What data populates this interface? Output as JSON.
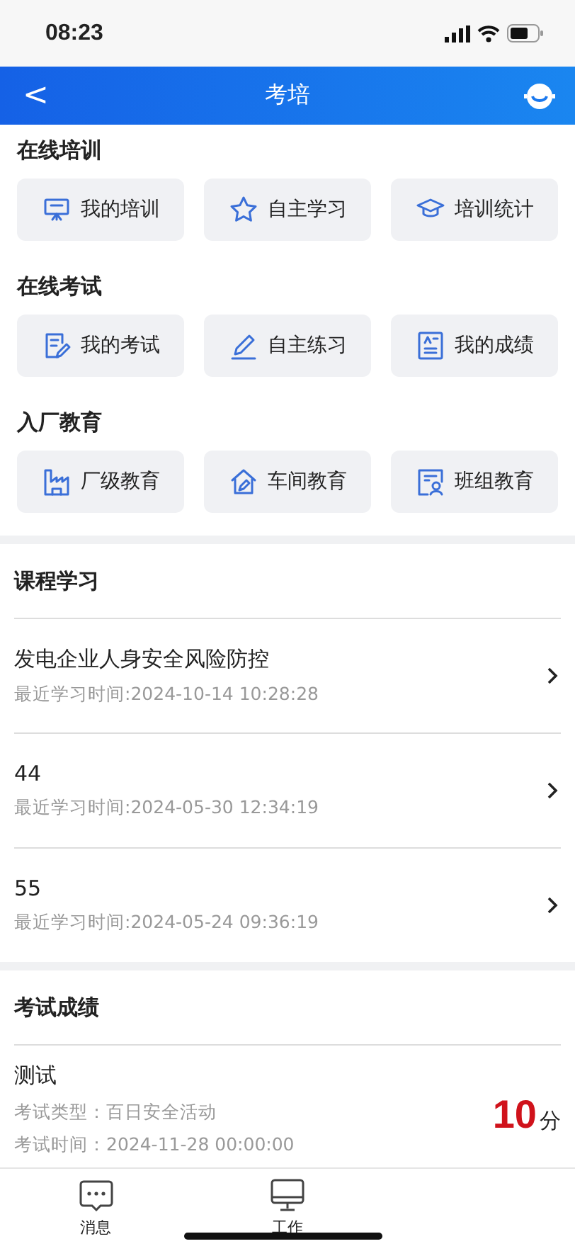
{
  "status_bar": {
    "time": "08:23"
  },
  "nav": {
    "back": "<",
    "title": "考培"
  },
  "sections": [
    {
      "title": "在线培训",
      "items": [
        "我的培训",
        "自主学习",
        "培训统计"
      ]
    },
    {
      "title": "在线考试",
      "items": [
        "我的考试",
        "自主练习",
        "我的成绩"
      ]
    },
    {
      "title": "入厂教育",
      "items": [
        "厂级教育",
        "车间教育",
        "班组教育"
      ]
    }
  ],
  "courses": {
    "title": "课程学习",
    "items": [
      {
        "name": "发电企业人身安全风险防控",
        "time": "最近学习时间:2024-10-14 10:28:28"
      },
      {
        "name": "44",
        "time": "最近学习时间:2024-05-30 12:34:19"
      },
      {
        "name": "55",
        "time": "最近学习时间:2024-05-24 09:36:19"
      }
    ]
  },
  "exam_results": {
    "title": "考试成绩",
    "items": [
      {
        "name": "测试",
        "type": "考试类型：百日安全活动",
        "time": "考试时间：2024-11-28 00:00:00",
        "score": "10",
        "unit": "分"
      }
    ]
  },
  "tab_bar": [
    {
      "label": "消息"
    },
    {
      "label": "工作"
    }
  ]
}
